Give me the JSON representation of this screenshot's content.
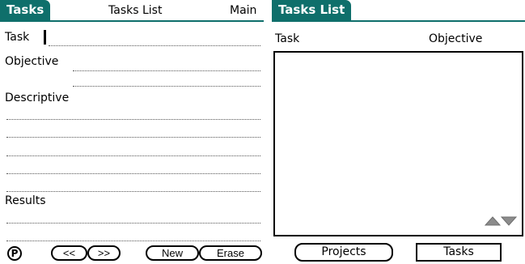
{
  "left": {
    "title": "Tasks",
    "menu": [
      "Tasks List",
      "Main"
    ],
    "fields": {
      "task_label": "Task",
      "objective_label": "Objective",
      "descriptive_label": "Descriptive",
      "results_label": "Results"
    },
    "buttons": {
      "p": "P",
      "prev": "<<",
      "next": ">>",
      "new": "New",
      "erase": "Erase"
    }
  },
  "right": {
    "title": "Tasks List",
    "columns": [
      "Task",
      "Objective"
    ],
    "rows": [],
    "scroll_icons": [
      "scroll-up-icon",
      "scroll-down-icon"
    ],
    "buttons": {
      "projects": "Projects",
      "tasks": "Tasks"
    }
  },
  "colors": {
    "title_bar": "#0f6f6b",
    "title_text": "#ffffff",
    "background": "#ffffff",
    "scroll_arrows": "#8c8c8c"
  }
}
